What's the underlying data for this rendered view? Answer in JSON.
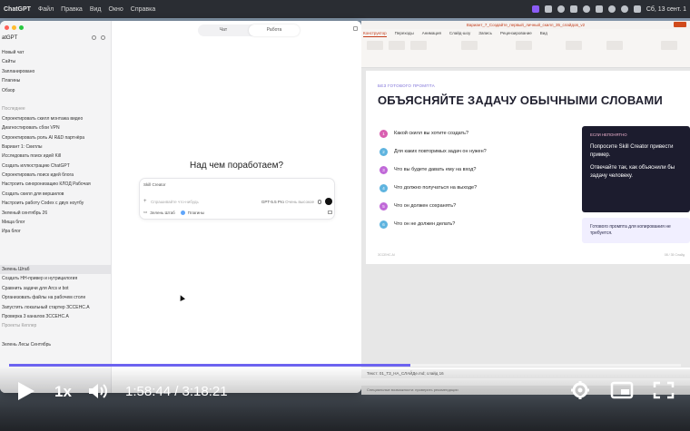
{
  "menubar": {
    "app": "ChatGPT",
    "items": [
      "Файл",
      "Правка",
      "Вид",
      "Окно",
      "Справка"
    ],
    "clock": "Сб, 13 сент. 1"
  },
  "chat": {
    "sidebar": {
      "title": "atGPT",
      "items": [
        {
          "label": "Новый чат",
          "type": "item"
        },
        {
          "label": "Сайты",
          "type": "item"
        },
        {
          "label": "Запланировано",
          "type": "item"
        },
        {
          "label": "Плагины",
          "type": "item"
        },
        {
          "label": "Обзор",
          "type": "item"
        },
        {
          "label": "",
          "type": "spacer"
        },
        {
          "label": "Последнее",
          "type": "section"
        },
        {
          "label": "Спроектировать скилл монтажа видео",
          "type": "item"
        },
        {
          "label": "Диагностировать сбои VPN",
          "type": "item"
        },
        {
          "label": "Спроектировать роль AI R&D партнёра",
          "type": "item"
        },
        {
          "label": "Вариант 1: Скиллы",
          "type": "item"
        },
        {
          "label": "Исследовать поиск идей Kill",
          "type": "item"
        },
        {
          "label": "Создать иллюстрацию ChatGPT",
          "type": "item"
        },
        {
          "label": "Спроектировать поиск идей блога",
          "type": "item"
        },
        {
          "label": "Настроить синхронизацию КЛОД Рабочая",
          "type": "item"
        },
        {
          "label": "Создать скилл для вершилов",
          "type": "item"
        },
        {
          "label": "Настроить работу Codex с двух ноутбу",
          "type": "item"
        },
        {
          "label": "Зеленый сентябрь 26",
          "type": "item"
        },
        {
          "label": "Мища блог",
          "type": "item"
        },
        {
          "label": "Ира блог",
          "type": "item"
        },
        {
          "label": "",
          "type": "spacer"
        },
        {
          "label": "",
          "type": "spacer"
        },
        {
          "label": "",
          "type": "spacer"
        },
        {
          "label": "Зелень Штаб",
          "type": "active"
        },
        {
          "label": "Создать НН-привер и нутрицилогия",
          "type": "item"
        },
        {
          "label": "Сравнить задачи для Arcs и bot",
          "type": "item"
        },
        {
          "label": "Организовать файлы на рабочем столе",
          "type": "item"
        },
        {
          "label": "Запустить локальный стартер ЗССЕНС.А",
          "type": "item"
        },
        {
          "label": "Проверка 3 каналов ЗССЕНС.А",
          "type": "item"
        },
        {
          "label": "Проекты Кеплер",
          "type": "section"
        },
        {
          "label": "",
          "type": "spacer"
        },
        {
          "label": "Зелень Лесы Сентябрь",
          "type": "item"
        }
      ]
    },
    "toggle": {
      "left": "Чат",
      "right": "Работа"
    },
    "heading": "Над чем поработаем?",
    "composer": {
      "chip": "Skill Creator",
      "placeholder": "Спрашивайте что-нибудь",
      "model": "GPT-5.5 Pro",
      "model_sub": "Очень высокое",
      "project": "Зелень Штаб",
      "plugins": "Плагины"
    }
  },
  "ppt": {
    "title": "Вариант_7_Создайте_первый_личный_скилл_35_слайдов_v2",
    "menu": [
      "Конструктор",
      "Переходы",
      "Анимация",
      "Слайд-шоу",
      "Запись",
      "Рецензирование",
      "Вид"
    ],
    "menu_selected": 0,
    "slide": {
      "kicker": "БЕЗ ГОТОВОГО ПРОМПТА",
      "title": "ОБЪЯСНЯЙТЕ ЗАДАЧУ ОБЫЧНЫМИ СЛОВАМИ",
      "questions": [
        {
          "n": "1",
          "text": "Какой скилл вы хотите создать?",
          "color": "#d95fb0"
        },
        {
          "n": "2",
          "text": "Для каких повторимых задач он нужен?",
          "color": "#5fb4df"
        },
        {
          "n": "3",
          "text": "Что вы будете давать ему на вход?",
          "color": "#c069d8"
        },
        {
          "n": "4",
          "text": "Что должно получаться на выходе?",
          "color": "#5fb4df"
        },
        {
          "n": "5",
          "text": "Что он должен сохранять?",
          "color": "#c069d8"
        },
        {
          "n": "6",
          "text": "Что он не должен делать?",
          "color": "#5fb4df"
        }
      ],
      "note": {
        "kicker": "ЕСЛИ НЕПОНЯТНО",
        "line1": "Попросите Skill Creator привести пример.",
        "line2": "Отвечайте так, как объяснили бы задачу человеку."
      },
      "card": "Готового промпта для копирования не требуется.",
      "footer": "ЗССЕНС.AI",
      "page": "08 / 35  Слайд"
    },
    "notes": "Текст: 01_ТЗ_НА_СЛАЙДе.md; слайд 16",
    "status": "Специальные возможности: проверить рекомендации"
  },
  "player": {
    "speed": "1x",
    "time": "1:58:44 / 3:18:21",
    "progress": 0.597
  },
  "colors": {
    "accent": "#6c63f0",
    "ppt_brand": "#c43e1c",
    "note_bg": "#1c1c2e"
  }
}
